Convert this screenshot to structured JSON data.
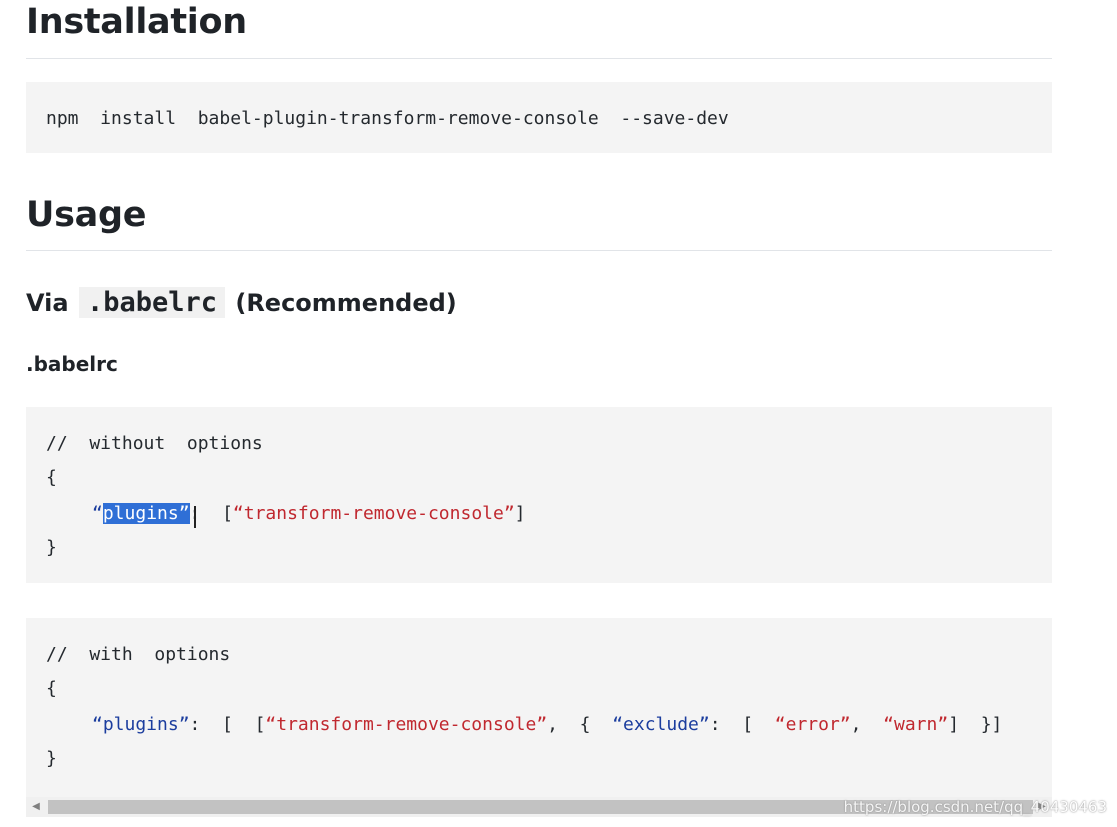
{
  "installation": {
    "heading": "Installation",
    "command": "npm  install  babel-plugin-transform-remove-console  --save-dev"
  },
  "usage": {
    "heading": "Usage",
    "subheading_prefix": "Via",
    "subheading_code": ".babelrc",
    "subheading_suffix": "(Recommended)",
    "file_label": ".babelrc"
  },
  "code_block_1": {
    "comment": "//  without  options",
    "open_brace": "{",
    "key_open_quote": "“",
    "key_selected": "plugins”",
    "colon": ":",
    "array_open": "  [",
    "value": "“transform-remove-console”",
    "array_close": "]",
    "close_brace": "}"
  },
  "code_block_2": {
    "comment": "//  with  options",
    "open_brace": "{",
    "key": "“plugins”",
    "sep1": ":  [  [",
    "value": "“transform-remove-console”",
    "sep2": ",  {  ",
    "option_key": "“exclude”",
    "sep3": ":  [  ",
    "opt_value_1": "“error”",
    "sep4": ",  ",
    "opt_value_2": "“warn”",
    "sep5": "]  }]",
    "close_brace": "}"
  },
  "scrollbar": {
    "left_arrow": "◀",
    "right_arrow": "▶"
  },
  "watermark": "https://blog.csdn.net/qq_40430463"
}
